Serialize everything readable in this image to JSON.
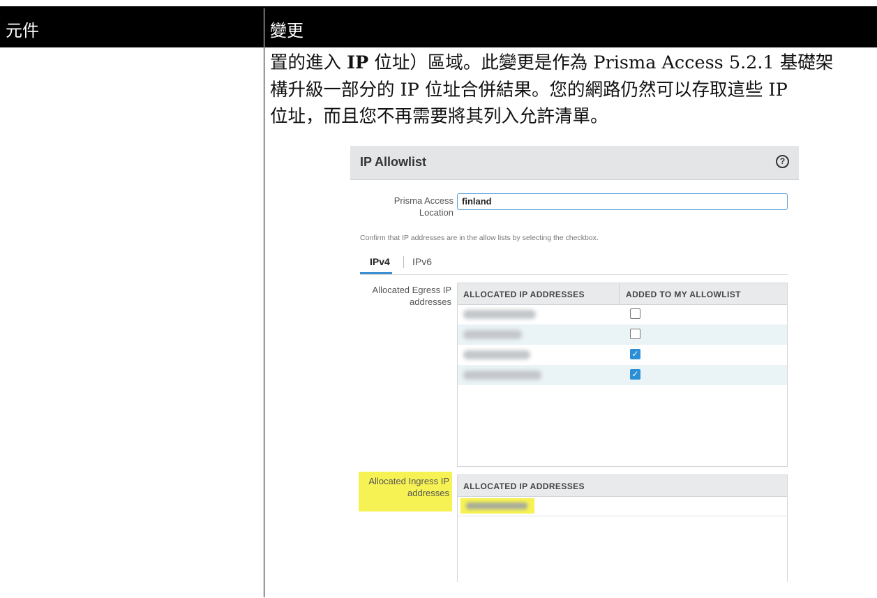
{
  "table": {
    "col1_header": "元件",
    "col2_header": "變更"
  },
  "body": {
    "line1_a": "置的進入 ",
    "line1_b": "IP",
    "line1_c": " 位址）區域。此變更是作為 Prisma Access 5.2.1 基礎架",
    "line2": "構升級一部分的 IP 位址合併結果。您的網路仍然可以存取這些 IP",
    "line3": "位址，而且您不再需要將其列入允許清單。"
  },
  "screenshot": {
    "title": "IP Allowlist",
    "help_icon": "?",
    "location_label_1": "Prisma Access",
    "location_label_2": "Location",
    "location_value": "finland",
    "confirm_text": "Confirm that IP addresses are in the allow lists by selecting the checkbox.",
    "tabs": [
      {
        "label": "IPv4",
        "active": true
      },
      {
        "label": "IPv6",
        "active": false
      }
    ],
    "egress_label_1": "Allocated Egress IP",
    "egress_label_2": "addresses",
    "egress_columns": [
      "ALLOCATED IP ADDRESSES",
      "ADDED TO MY ALLOWLIST"
    ],
    "egress_rows": [
      {
        "ip_blurred": true,
        "checked": false
      },
      {
        "ip_blurred": true,
        "checked": false
      },
      {
        "ip_blurred": true,
        "checked": true
      },
      {
        "ip_blurred": true,
        "checked": true
      }
    ],
    "ingress_label_1": "Allocated Ingress IP",
    "ingress_label_2": "addresses",
    "ingress_columns": [
      "ALLOCATED IP ADDRESSES"
    ],
    "highlight_color": "#f6f254",
    "accent_color": "#2c8fd6"
  }
}
